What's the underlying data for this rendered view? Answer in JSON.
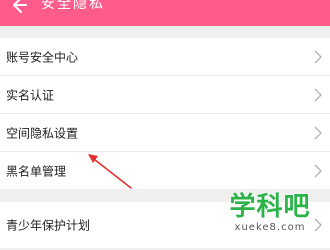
{
  "header": {
    "title": "安全隐私",
    "back_icon": "back-arrow-icon",
    "bg_color": "#ff5c8c"
  },
  "settings": {
    "items": [
      {
        "label": "账号安全中心",
        "icon": "chevron-right-icon"
      },
      {
        "label": "实名认证",
        "icon": "chevron-right-icon"
      },
      {
        "label": "空间隐私设置",
        "icon": "chevron-right-icon"
      },
      {
        "label": "黑名单管理",
        "icon": "chevron-right-icon"
      }
    ],
    "youth": {
      "label": "青少年保护计划",
      "icon": "chevron-right-icon"
    }
  },
  "annotation": {
    "type": "red-arrow",
    "color": "#e03030"
  },
  "watermark": {
    "title": "学科吧",
    "url": "xueke8.com",
    "color": "#2bb34a"
  }
}
